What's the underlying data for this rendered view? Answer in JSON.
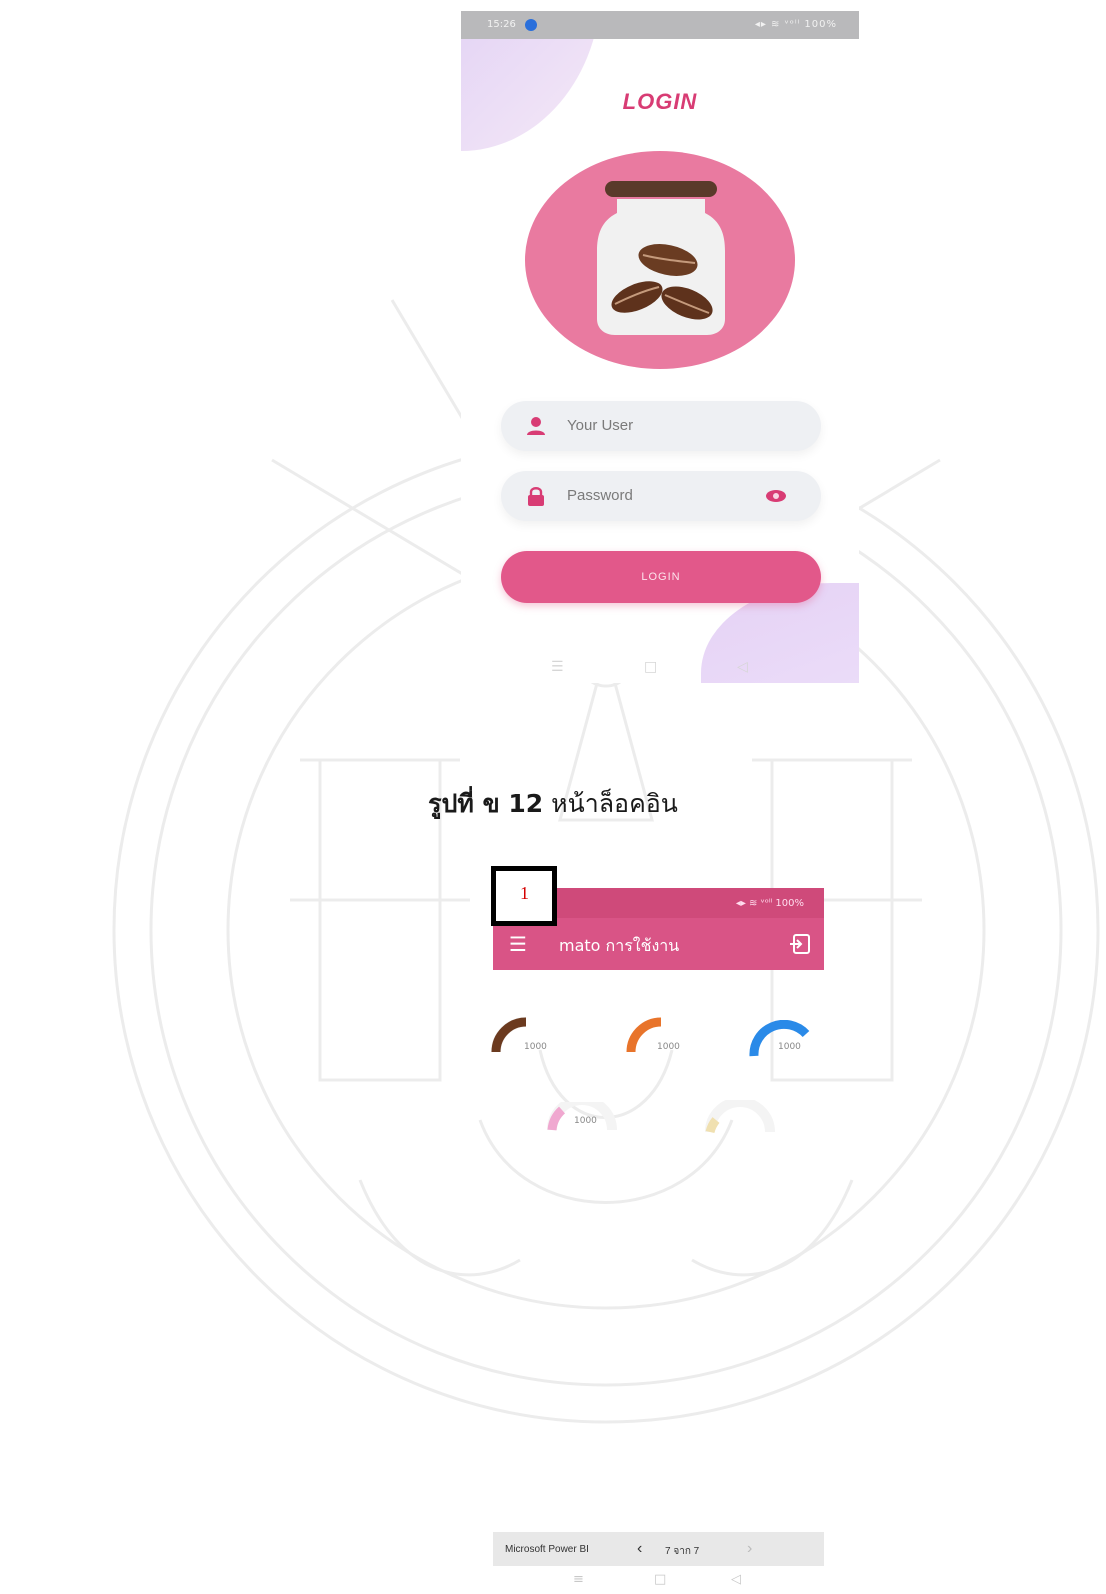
{
  "login_screen": {
    "status_time": "15:26",
    "status_indicators": "◂▸ ≋ ᵛᵒˡˡ 100%",
    "title": "LOGIN",
    "username_placeholder": "Your User",
    "password_placeholder": "Password",
    "login_button": "LOGIN",
    "nav_menu": "☰",
    "nav_home": "□",
    "nav_back": "◁"
  },
  "caption": {
    "label": "รูปที่ ข 12",
    "text": "หน้าล็อคอิน"
  },
  "annotation": {
    "marker": "1"
  },
  "dashboard": {
    "status_indicators": "◂▸ ≋ ᵛᵒˡˡ 100%",
    "menu_icon": "☰",
    "title": "mato การใช้งาน",
    "gauges": [
      {
        "value": "1000",
        "color": "#6b3a1f"
      },
      {
        "value": "1000",
        "color": "#e8742b"
      },
      {
        "value": "1000",
        "color": "#2a8ae8"
      },
      {
        "value": "1000",
        "color": "#f0a8d0"
      },
      {
        "value": "",
        "color": "#f0e0b0"
      }
    ]
  },
  "viewer_bar": {
    "app_name": "Microsoft Power BI",
    "prev": "‹",
    "page_indicator": "7 จาก 7",
    "next": "›",
    "nav_menu": "≡",
    "nav_home": "□",
    "nav_back": "◁"
  },
  "colors": {
    "brand_pink": "#e2588a",
    "title_pink": "#d83c74",
    "logo_circle": "#e97aa0",
    "annotation_red": "#d40000"
  }
}
